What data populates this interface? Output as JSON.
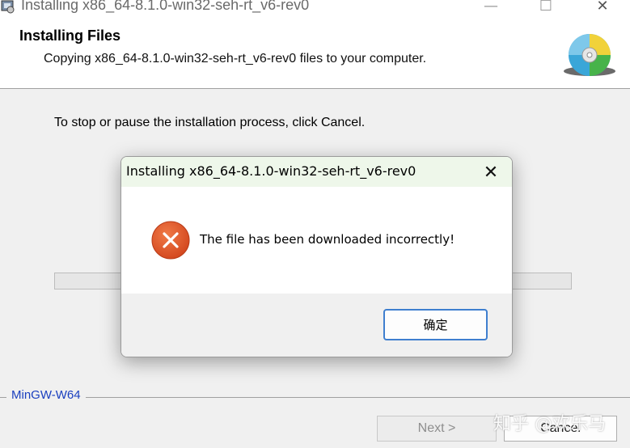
{
  "window": {
    "title": "Installing x86_64-8.1.0-win32-seh-rt_v6-rev0",
    "minimize_glyph": "—",
    "maximize_glyph": "☐",
    "close_glyph": "✕"
  },
  "header": {
    "title": "Installing Files",
    "subtitle": "Copying x86_64-8.1.0-win32-seh-rt_v6-rev0 files to your computer."
  },
  "body": {
    "instruction": "To stop or pause the installation process, click Cancel."
  },
  "progress": {
    "fraction": 0
  },
  "footer": {
    "brand": "MinGW-W64",
    "next_label": "Next >",
    "cancel_label": "Cancel",
    "watermark": "知乎 @欢乐马"
  },
  "dialog": {
    "title": "Installing x86_64-8.1.0-win32-seh-rt_v6-rev0",
    "close_glyph": "✕",
    "message": "The file has been downloaded incorrectly!",
    "ok_label": "确定"
  },
  "colors": {
    "error_icon": "#e0542a",
    "dialog_titlebar": "#eef7ea",
    "ok_button_border": "#3f7fcf",
    "brand_text": "#1a3fbf"
  },
  "icons": [
    "installer-app-icon",
    "cd-disc-icon",
    "error-icon",
    "close-icon"
  ]
}
